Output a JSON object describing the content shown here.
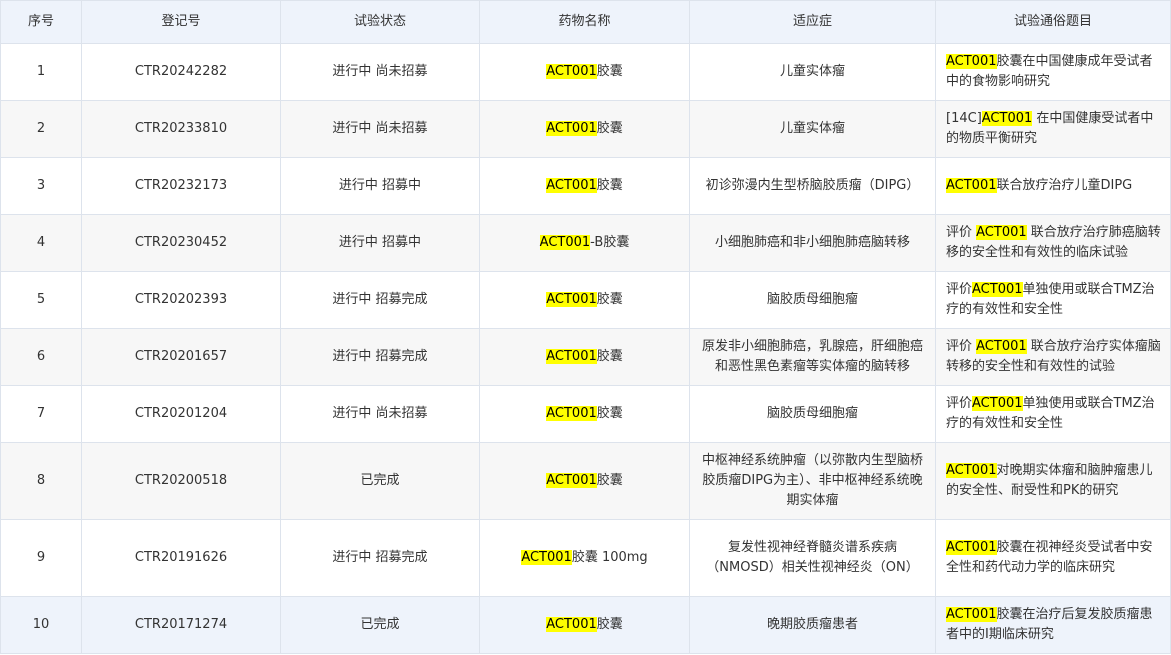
{
  "table": {
    "headers": [
      "序号",
      "登记号",
      "试验状态",
      "药物名称",
      "适应症",
      "试验通俗题目"
    ],
    "highlight_color": "#ffff00",
    "rows": [
      {
        "no": "1",
        "reg": "CTR20242282",
        "status": "进行中 尚未招募",
        "drug": [
          {
            "t": "ACT001",
            "h": true
          },
          {
            "t": "胶囊",
            "h": false
          }
        ],
        "indication": "儿童实体瘤",
        "title": [
          {
            "t": "ACT001",
            "h": true
          },
          {
            "t": "胶囊在中国健康成年受试者中的食物影响研究",
            "h": false
          }
        ]
      },
      {
        "no": "2",
        "reg": "CTR20233810",
        "status": "进行中 尚未招募",
        "drug": [
          {
            "t": "ACT001",
            "h": true
          },
          {
            "t": "胶囊",
            "h": false
          }
        ],
        "indication": "儿童实体瘤",
        "title": [
          {
            "t": "[14C]",
            "h": false
          },
          {
            "t": "ACT001",
            "h": true
          },
          {
            "t": " 在中国健康受试者中的物质平衡研究",
            "h": false
          }
        ]
      },
      {
        "no": "3",
        "reg": "CTR20232173",
        "status": "进行中 招募中",
        "drug": [
          {
            "t": "ACT001",
            "h": true
          },
          {
            "t": "胶囊",
            "h": false
          }
        ],
        "indication": "初诊弥漫内生型桥脑胶质瘤（DIPG）",
        "title": [
          {
            "t": "ACT001",
            "h": true
          },
          {
            "t": "联合放疗治疗儿童DIPG",
            "h": false
          }
        ]
      },
      {
        "no": "4",
        "reg": "CTR20230452",
        "status": "进行中 招募中",
        "drug": [
          {
            "t": "ACT001",
            "h": true
          },
          {
            "t": "-B胶囊",
            "h": false
          }
        ],
        "indication": "小细胞肺癌和非小细胞肺癌脑转移",
        "title": [
          {
            "t": "评价 ",
            "h": false
          },
          {
            "t": "ACT001",
            "h": true
          },
          {
            "t": " 联合放疗治疗肺癌脑转移的安全性和有效性的临床试验",
            "h": false
          }
        ]
      },
      {
        "no": "5",
        "reg": "CTR20202393",
        "status": "进行中 招募完成",
        "drug": [
          {
            "t": "ACT001",
            "h": true
          },
          {
            "t": "胶囊",
            "h": false
          }
        ],
        "indication": "脑胶质母细胞瘤",
        "title": [
          {
            "t": "评价",
            "h": false
          },
          {
            "t": "ACT001",
            "h": true
          },
          {
            "t": "单独使用或联合TMZ治疗的有效性和安全性",
            "h": false
          }
        ]
      },
      {
        "no": "6",
        "reg": "CTR20201657",
        "status": "进行中 招募完成",
        "drug": [
          {
            "t": "ACT001",
            "h": true
          },
          {
            "t": "胶囊",
            "h": false
          }
        ],
        "indication": "原发非小细胞肺癌，乳腺癌，肝细胞癌和恶性黑色素瘤等实体瘤的脑转移",
        "title": [
          {
            "t": "评价 ",
            "h": false
          },
          {
            "t": "ACT001",
            "h": true
          },
          {
            "t": " 联合放疗治疗实体瘤脑转移的安全性和有效性的试验",
            "h": false
          }
        ]
      },
      {
        "no": "7",
        "reg": "CTR20201204",
        "status": "进行中 尚未招募",
        "drug": [
          {
            "t": "ACT001",
            "h": true
          },
          {
            "t": "胶囊",
            "h": false
          }
        ],
        "indication": "脑胶质母细胞瘤",
        "title": [
          {
            "t": "评价",
            "h": false
          },
          {
            "t": "ACT001",
            "h": true
          },
          {
            "t": "单独使用或联合TMZ治疗的有效性和安全性",
            "h": false
          }
        ]
      },
      {
        "no": "8",
        "reg": "CTR20200518",
        "status": "已完成",
        "drug": [
          {
            "t": "ACT001",
            "h": true
          },
          {
            "t": "胶囊",
            "h": false
          }
        ],
        "indication": "中枢神经系统肿瘤（以弥散内生型脑桥胶质瘤DIPG为主）、非中枢神经系统晚期实体瘤",
        "title": [
          {
            "t": "ACT001",
            "h": true
          },
          {
            "t": "对晚期实体瘤和脑肿瘤患儿的安全性、耐受性和PK的研究",
            "h": false
          }
        ]
      },
      {
        "no": "9",
        "reg": "CTR20191626",
        "status": "进行中 招募完成",
        "drug": [
          {
            "t": "ACT001",
            "h": true
          },
          {
            "t": "胶囊 100mg",
            "h": false
          }
        ],
        "indication": "复发性视神经脊髓炎谱系疾病（NMOSD）相关性视神经炎（ON）",
        "title": [
          {
            "t": "ACT001",
            "h": true
          },
          {
            "t": "胶囊在视神经炎受试者中安全性和药代动力学的临床研究",
            "h": false
          }
        ]
      },
      {
        "no": "10",
        "reg": "CTR20171274",
        "status": "已完成",
        "drug": [
          {
            "t": "ACT001",
            "h": true
          },
          {
            "t": "胶囊",
            "h": false
          }
        ],
        "indication": "晚期胶质瘤患者",
        "title": [
          {
            "t": "ACT001",
            "h": true
          },
          {
            "t": "胶囊在治疗后复发胶质瘤患者中的I期临床研究",
            "h": false
          }
        ]
      }
    ]
  }
}
